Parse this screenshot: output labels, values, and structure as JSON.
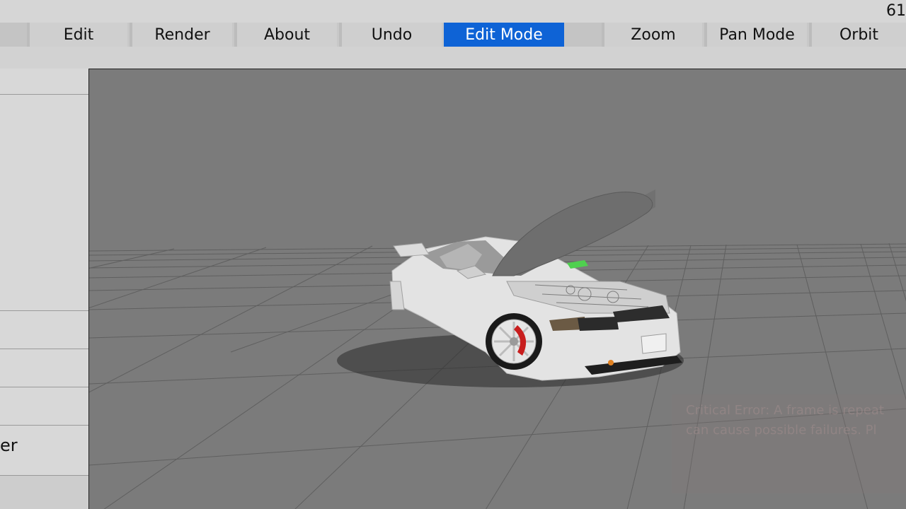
{
  "topbar": {
    "fps": "61"
  },
  "menu": {
    "items": [
      {
        "label": "Edit"
      },
      {
        "label": "Render"
      },
      {
        "label": "About"
      },
      {
        "label": "Undo"
      },
      {
        "label": "Edit Mode",
        "active": true
      },
      {
        "label": "Zoom"
      },
      {
        "label": "Pan Mode"
      },
      {
        "label": "Orbit"
      }
    ]
  },
  "sidebar": {
    "label": "er"
  },
  "viewport": {
    "toast": {
      "line1": "Critical Error: A frame is repeat",
      "line2": "can cause possible failures. Pl"
    }
  },
  "colors": {
    "accent": "#0e63d6",
    "viewport_bg": "#7a7a7a",
    "car_body": "#e2e2e2",
    "brake_caliper": "#c81e1e"
  }
}
